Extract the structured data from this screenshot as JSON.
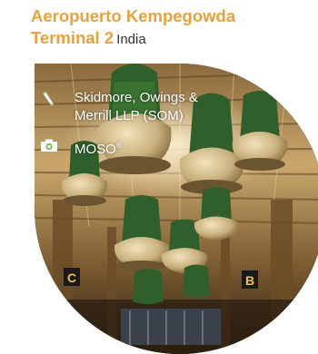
{
  "project": {
    "name_line1": "Aeropuerto Kempegowda",
    "name_line2": "Terminal 2",
    "country": "India"
  },
  "credits": {
    "architect_line1": "Skidmore, Owings &",
    "architect_line2": "Merrill LLP (SOM)",
    "photographer": "MOSO",
    "photographer_mark": "®"
  },
  "icons": {
    "architect": "pencil-icon",
    "photographer": "camera-icon"
  },
  "colors": {
    "title": "#eaa13a",
    "text": "#333333",
    "credit_text": "#ffffff",
    "icon_green": "#6cc04a"
  }
}
